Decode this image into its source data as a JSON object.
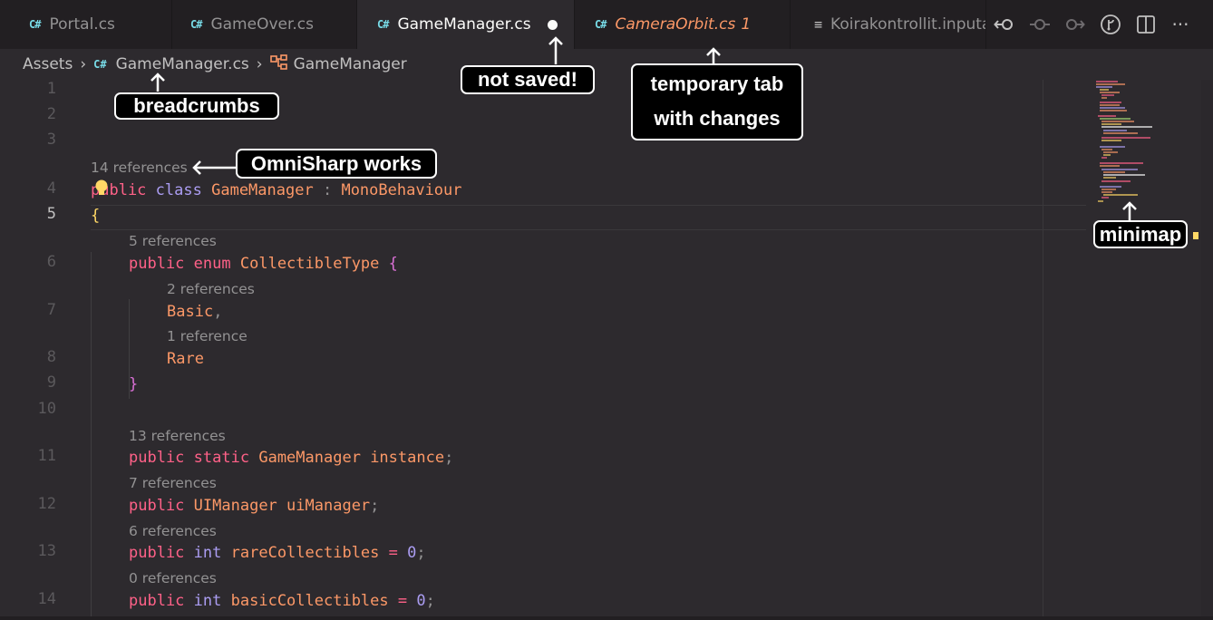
{
  "tabs": [
    {
      "label": "Portal.cs",
      "icon": "csharp-file-icon"
    },
    {
      "label": "GameOver.cs",
      "icon": "csharp-file-icon"
    },
    {
      "label": "GameManager.cs",
      "icon": "csharp-file-icon",
      "active": true,
      "dirty": true
    },
    {
      "label": "CameraOrbit.cs",
      "problems": "1",
      "icon": "csharp-file-icon",
      "preview": true
    },
    {
      "label": "Koirakontrollit.inputactions",
      "icon": "list-file-icon"
    }
  ],
  "tab_actions": [
    "git-go-back-icon",
    "git-commit-icon",
    "git-go-forward-icon",
    "git-graph-icon",
    "split-editor-icon",
    "more-actions-icon"
  ],
  "breadcrumb": {
    "folder": "Assets",
    "file": "GameManager.cs",
    "symbol": "GameManager"
  },
  "editor": {
    "current_line": "5",
    "lines": [
      {
        "n": "1"
      },
      {
        "n": "2"
      },
      {
        "n": "3"
      },
      {
        "n": "4",
        "lens": "14 references"
      },
      {
        "n": "5"
      },
      {
        "n": "6",
        "lens": "5 references"
      },
      {
        "n": "7",
        "lens": "2 references"
      },
      {
        "n": "8",
        "lens": "1 reference"
      },
      {
        "n": "9"
      },
      {
        "n": "10"
      },
      {
        "n": "11",
        "lens": "13 references"
      },
      {
        "n": "12",
        "lens": "7 references"
      },
      {
        "n": "13",
        "lens": "6 references"
      },
      {
        "n": "14",
        "lens": "0 references"
      }
    ],
    "code": {
      "l4": {
        "kw1": "public",
        "kw2": "class",
        "name": "GameManager",
        "colon": ":",
        "base": "MonoBehaviour"
      },
      "l5": {
        "brace": "{"
      },
      "l6": {
        "kw1": "public",
        "kw2": "enum",
        "name": "CollectibleType",
        "brace": "{"
      },
      "l7": {
        "member": "Basic",
        "comma": ","
      },
      "l8": {
        "member": "Rare"
      },
      "l9": {
        "brace": "}"
      },
      "l11": {
        "kw1": "public",
        "kw2": "static",
        "type": "GameManager",
        "name": "instance",
        "semi": ";"
      },
      "l12": {
        "kw1": "public",
        "type": "UIManager",
        "name": "uiManager",
        "semi": ";"
      },
      "l13": {
        "kw1": "public",
        "type": "int",
        "name": "rareCollectibles",
        "eq": "=",
        "val": "0",
        "semi": ";"
      },
      "l14": {
        "kw1": "public",
        "type": "int",
        "name": "basicCollectibles",
        "eq": "=",
        "val": "0",
        "semi": ";"
      }
    }
  },
  "annotations": {
    "breadcrumbs": "breadcrumbs",
    "not_saved": "not saved!",
    "temporary_tab_1": "temporary tab",
    "temporary_tab_2": "with changes",
    "omnisharp": "OmniSharp works",
    "minimap": "minimap"
  },
  "colors": {
    "background": "#2d2a2e",
    "tabbar": "#221f22",
    "keyword": "#ff6188",
    "type": "#fc9867",
    "identifier": "#ffd866",
    "number": "#ab9df2",
    "csharp_icon": "#78dce8"
  }
}
